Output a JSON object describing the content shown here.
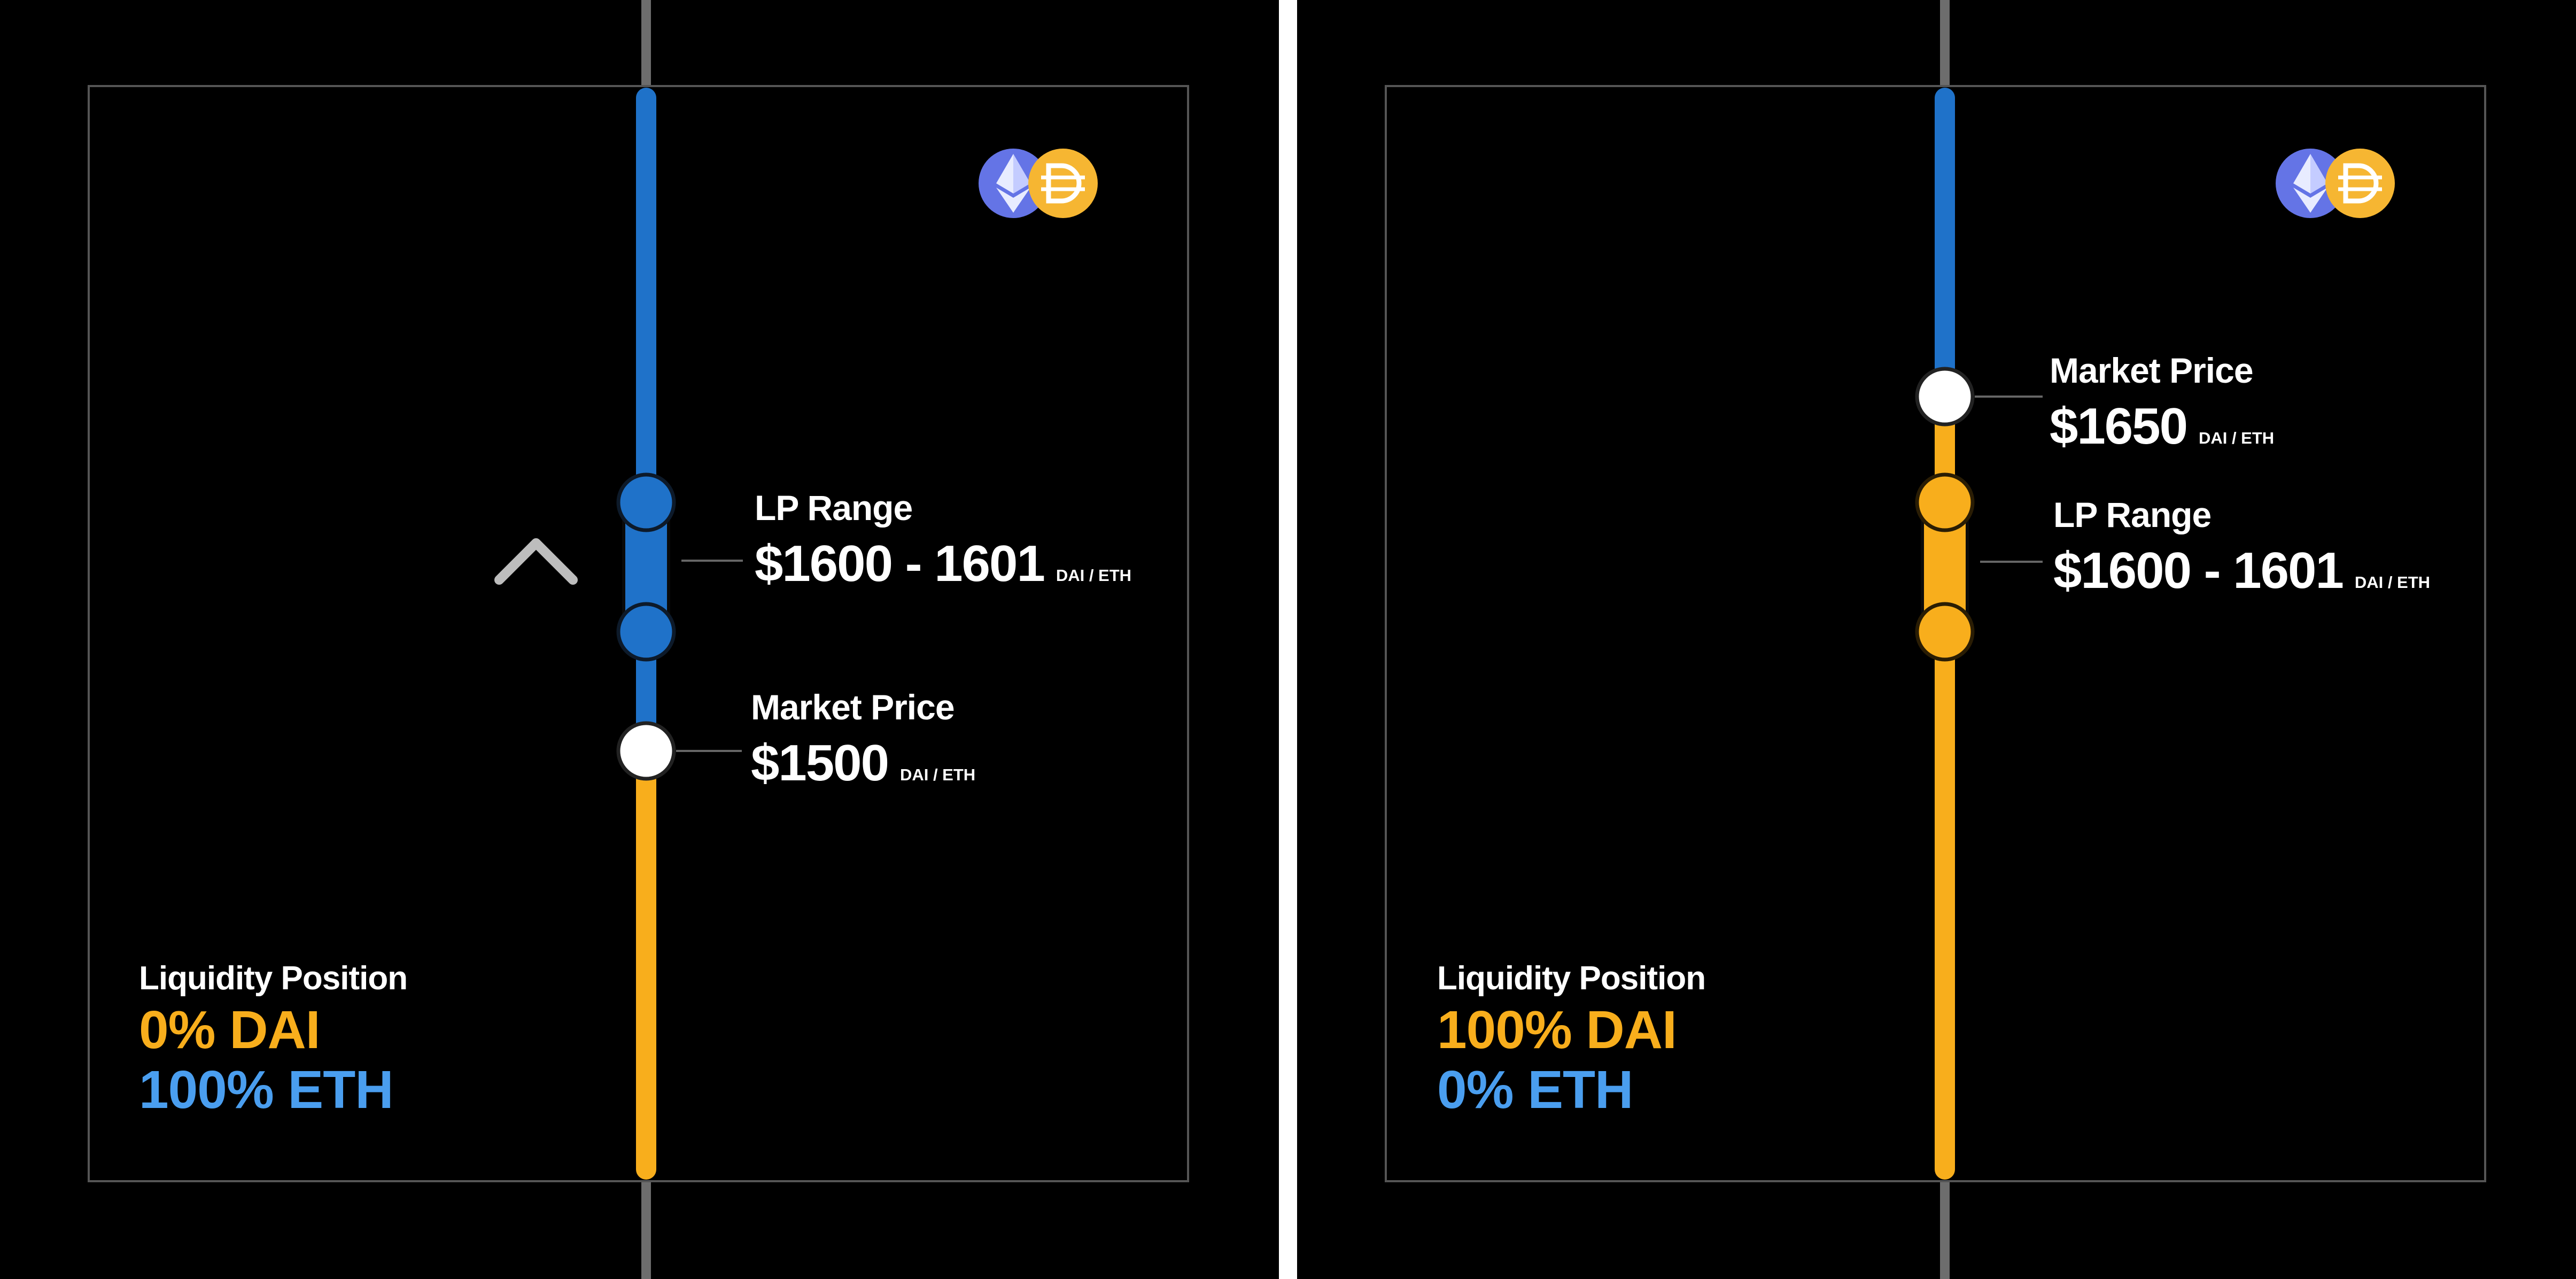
{
  "colors": {
    "eth_blue": "#1f72c9",
    "dai_orange": "#f8ae1c",
    "text_blue": "#4a9eef",
    "white": "#ffffff",
    "background": "#000000",
    "frame": "#555555",
    "axis": "#6d6d6d"
  },
  "icons": [
    "eth-token-icon",
    "dai-token-icon"
  ],
  "panels": [
    {
      "market_price": {
        "title": "Market Price",
        "value": "$1500",
        "unit": "DAI / ETH"
      },
      "lp_range": {
        "title": "LP Range",
        "value": "$1600 - 1601",
        "unit": "DAI / ETH"
      },
      "liquidity": {
        "title": "Liquidity Position",
        "dai": "0% DAI",
        "eth": "100% ETH"
      },
      "arrow": "up-arrow"
    },
    {
      "market_price": {
        "title": "Market Price",
        "value": "$1650",
        "unit": "DAI / ETH"
      },
      "lp_range": {
        "title": "LP Range",
        "value": "$1600 - 1601",
        "unit": "DAI / ETH"
      },
      "liquidity": {
        "title": "Liquidity Position",
        "dai": "100% DAI",
        "eth": "0% ETH"
      }
    }
  ]
}
